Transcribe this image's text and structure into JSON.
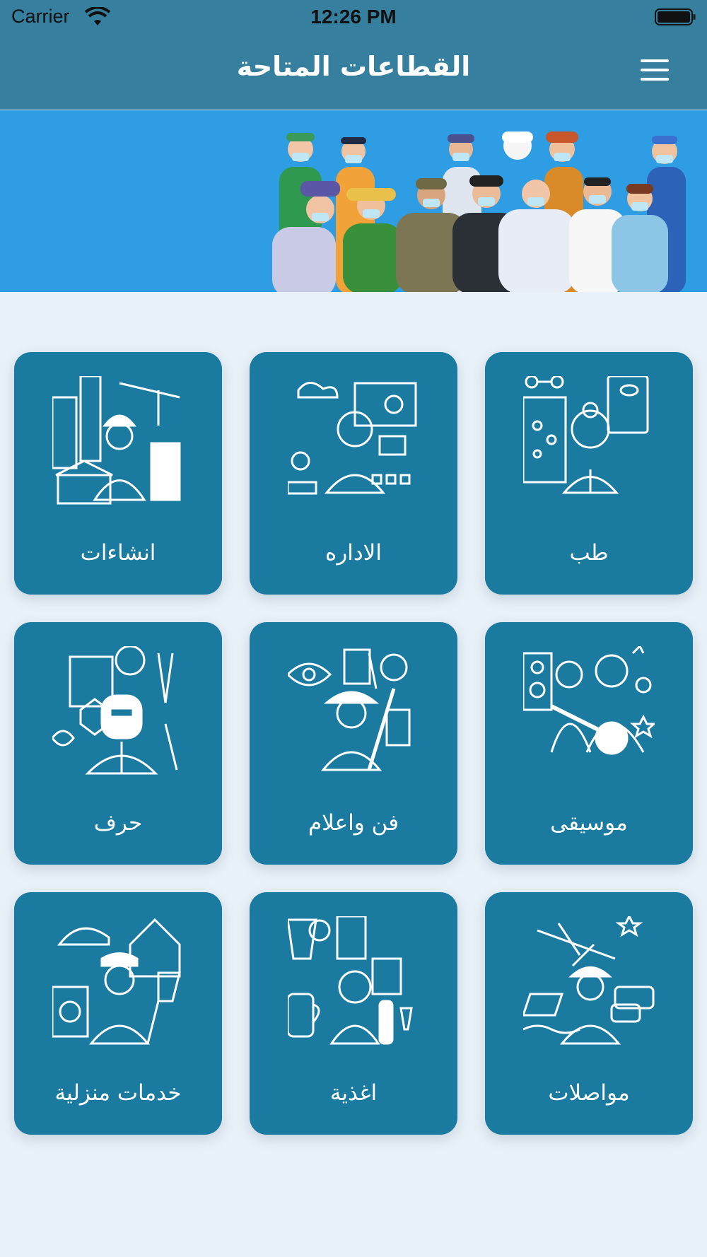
{
  "status_bar": {
    "carrier": "Carrier",
    "time": "12:26 PM"
  },
  "header": {
    "title": "القطاعات المتاحة",
    "menu_icon": "hamburger-menu-icon"
  },
  "banner": {
    "image": "group-of-masked-workers-illustration"
  },
  "colors": {
    "header": "#367f9f",
    "banner": "#2e9de3",
    "card": "#1b7aa0",
    "background": "#e9f1f8"
  },
  "sectors": [
    {
      "label": "طب",
      "icon": "doctor-icon"
    },
    {
      "label": "الاداره",
      "icon": "administration-icon"
    },
    {
      "label": "انشاءات",
      "icon": "construction-worker-icon"
    },
    {
      "label": "موسيقى",
      "icon": "musician-icon"
    },
    {
      "label": "فن واعلام",
      "icon": "artist-icon"
    },
    {
      "label": "حرف",
      "icon": "welder-icon"
    },
    {
      "label": "مواصلات",
      "icon": "transport-pilot-icon"
    },
    {
      "label": "اغذية",
      "icon": "food-server-icon"
    },
    {
      "label": "خدمات منزلية",
      "icon": "housekeeper-icon"
    }
  ]
}
